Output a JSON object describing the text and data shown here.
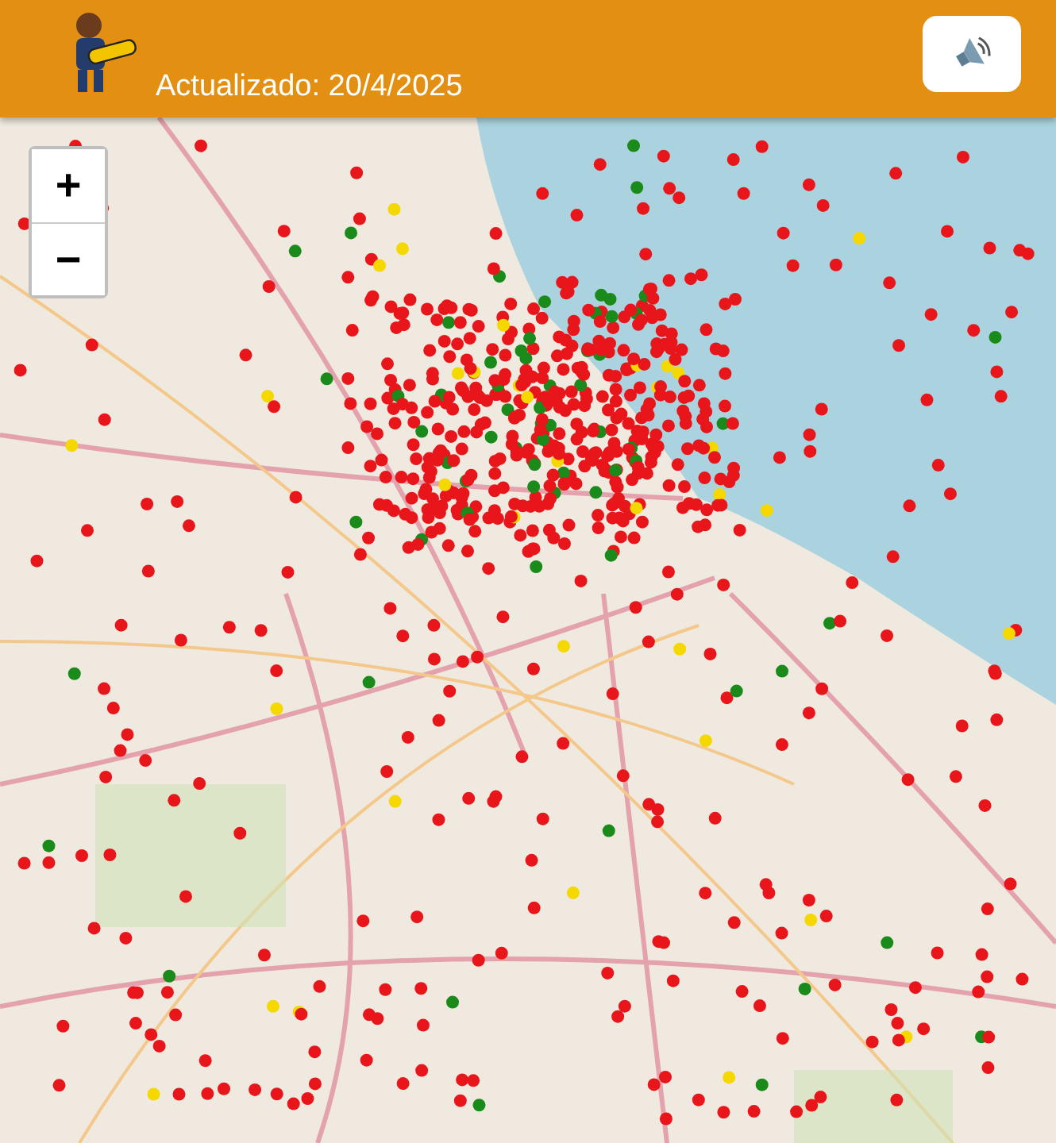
{
  "header": {
    "updated": "Actualizado: 20/4/2025"
  },
  "zoom_controls": [
    {
      "label": "+"
    },
    {
      "label": "−"
    }
  ]
}
